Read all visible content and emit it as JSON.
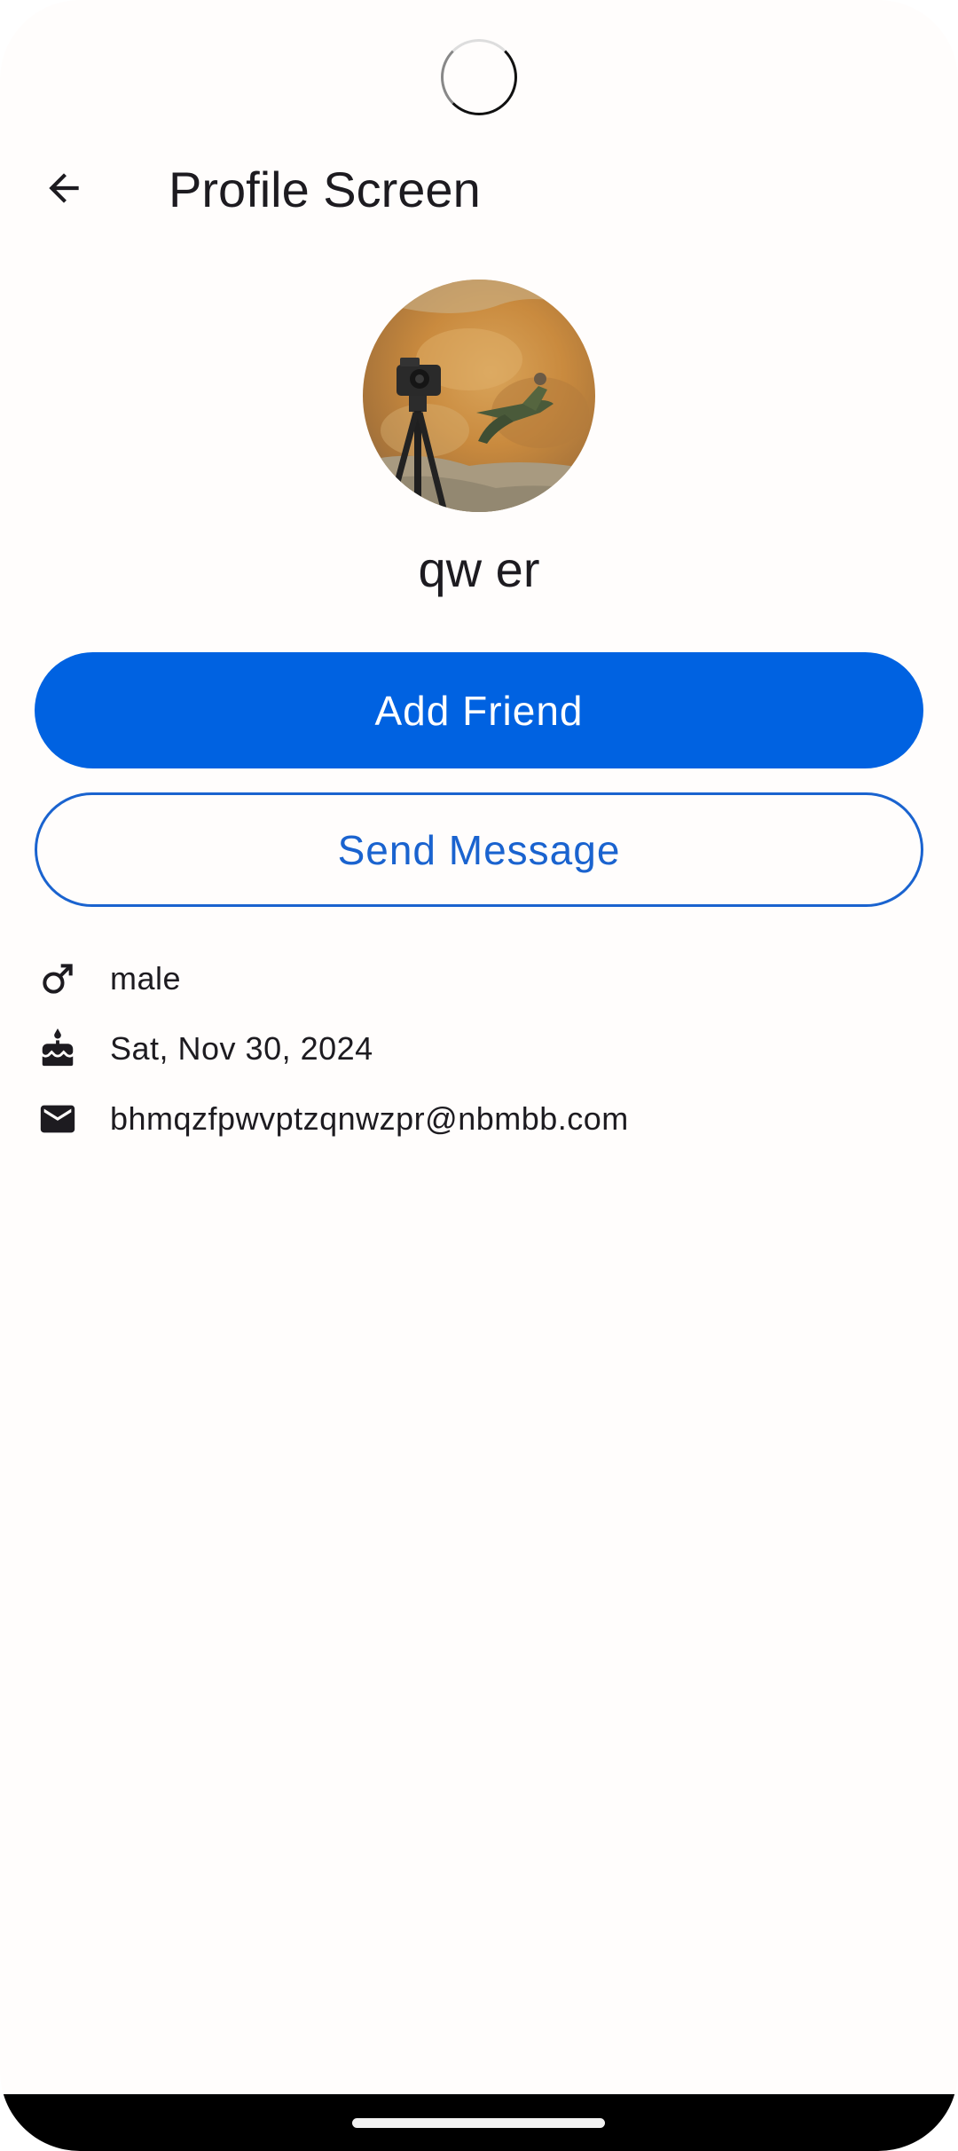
{
  "app_bar": {
    "title": "Profile Screen",
    "back_icon": "arrow-back-icon"
  },
  "profile": {
    "name": "qw er",
    "avatar_icon": "profile-photo"
  },
  "actions": {
    "add_friend_label": "Add Friend",
    "send_message_label": "Send Message"
  },
  "details": {
    "gender": {
      "icon": "male-icon",
      "text": "male"
    },
    "birthday": {
      "icon": "cake-icon",
      "text": "Sat, Nov 30, 2024"
    },
    "email": {
      "icon": "mail-icon",
      "text": "bhmqzfpwvptzqnwzpr@nbmbb.com"
    }
  },
  "colors": {
    "primary": "#0062e1",
    "outline": "#1a63cf",
    "text": "#1d1b20",
    "background": "#fffdfc"
  }
}
